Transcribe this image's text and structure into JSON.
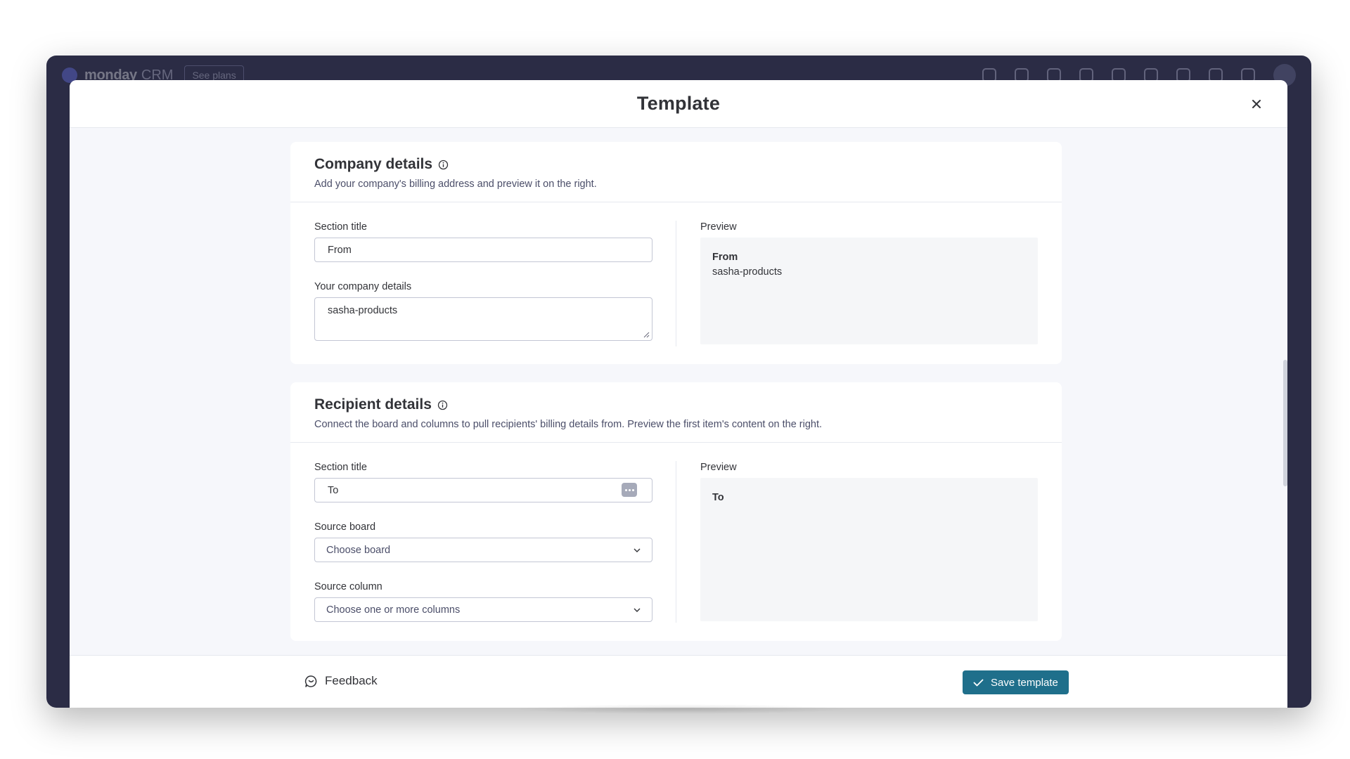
{
  "app": {
    "logo_text": "monday",
    "logo_sub": "CRM",
    "see_plans_label": "See plans"
  },
  "modal": {
    "title": "Template",
    "close_icon": "close-icon"
  },
  "company_section": {
    "title": "Company details",
    "subtitle": "Add your company's billing address and preview it on the right.",
    "section_title_label": "Section title",
    "section_title_value": "From",
    "company_details_label": "Your company details",
    "company_details_value": "sasha-products",
    "preview_label": "Preview",
    "preview_heading": "From",
    "preview_line": "sasha-products"
  },
  "recipient_section": {
    "title": "Recipient details",
    "subtitle": "Connect the board and columns to pull recipients' billing details from. Preview the first item's content on the right.",
    "section_title_label": "Section title",
    "section_title_value": "To",
    "source_board_label": "Source board",
    "source_board_placeholder": "Choose board",
    "source_column_label": "Source column",
    "source_column_placeholder": "Choose one or more columns",
    "preview_label": "Preview",
    "preview_heading": "To"
  },
  "footer": {
    "feedback_label": "Feedback",
    "save_label": "Save template"
  },
  "colors": {
    "primary_button": "#1f6f8b",
    "modal_background": "#f6f7fb",
    "app_background": "#2b2c45"
  }
}
